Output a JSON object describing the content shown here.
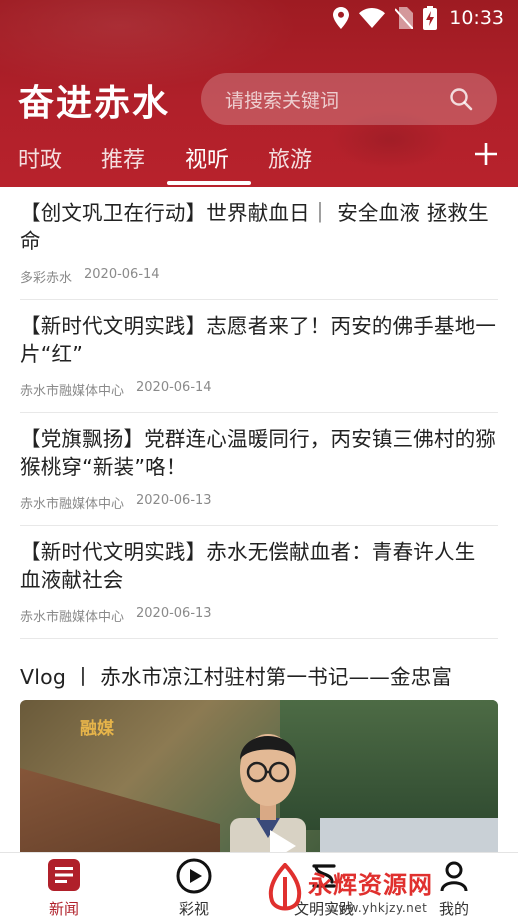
{
  "status_bar": {
    "time": "10:33"
  },
  "header": {
    "app_title": "奋进赤水",
    "search_placeholder": "请搜索关键词"
  },
  "tabs": [
    {
      "label": "时政",
      "active": false
    },
    {
      "label": "推荐",
      "active": false
    },
    {
      "label": "视听",
      "active": true
    },
    {
      "label": "旅游",
      "active": false
    }
  ],
  "news": [
    {
      "title": "【创文巩卫在行动】世界献血日｜ 安全血液 拯救生命",
      "source": "多彩赤水",
      "date": "2020-06-14"
    },
    {
      "title": "【新时代文明实践】志愿者来了！丙安的佛手基地一片“红”",
      "source": "赤水市融媒体中心",
      "date": "2020-06-14"
    },
    {
      "title": "【党旗飘扬】党群连心温暖同行，丙安镇三佛村的猕猴桃穿“新装”咯！",
      "source": "赤水市融媒体中心",
      "date": "2020-06-13"
    },
    {
      "title": "【新时代文明实践】赤水无偿献血者：青春许人生 血液献社会",
      "source": "赤水市融媒体中心",
      "date": "2020-06-13"
    }
  ],
  "video": {
    "title": "Vlog 丨 赤水市凉江村驻村第一书记——金忠富",
    "thumb_logo": "融媒"
  },
  "bottom_nav": [
    {
      "label": "新闻",
      "icon": "news-icon",
      "active": true
    },
    {
      "label": "彩视",
      "icon": "play-circle-icon",
      "active": false
    },
    {
      "label": "文明实践",
      "icon": "civic-icon",
      "active": false
    },
    {
      "label": "我的",
      "icon": "user-icon",
      "active": false
    }
  ],
  "watermark": {
    "text": "永辉资源网",
    "url": "www.yhkjzy.net"
  },
  "colors": {
    "brand": "#b0202a",
    "header_dark": "#9e1b22"
  }
}
